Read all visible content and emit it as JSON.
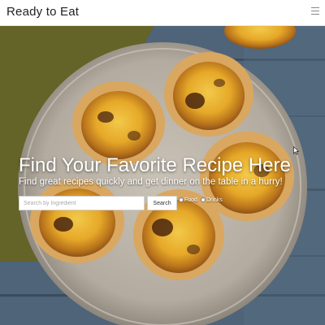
{
  "navbar": {
    "brand": "Ready to Eat",
    "menu_icon": "hamburger-menu-icon"
  },
  "hero": {
    "title": "Find Your Favorite Recipe Here",
    "subtitle": "Find great recipes quickly and get dinner on the table in a hurry!",
    "search": {
      "placeholder": "Search by Ingredient",
      "value": "",
      "button_label": "Search"
    },
    "filters": [
      {
        "label": "Food"
      },
      {
        "label": "Drinks"
      }
    ]
  }
}
